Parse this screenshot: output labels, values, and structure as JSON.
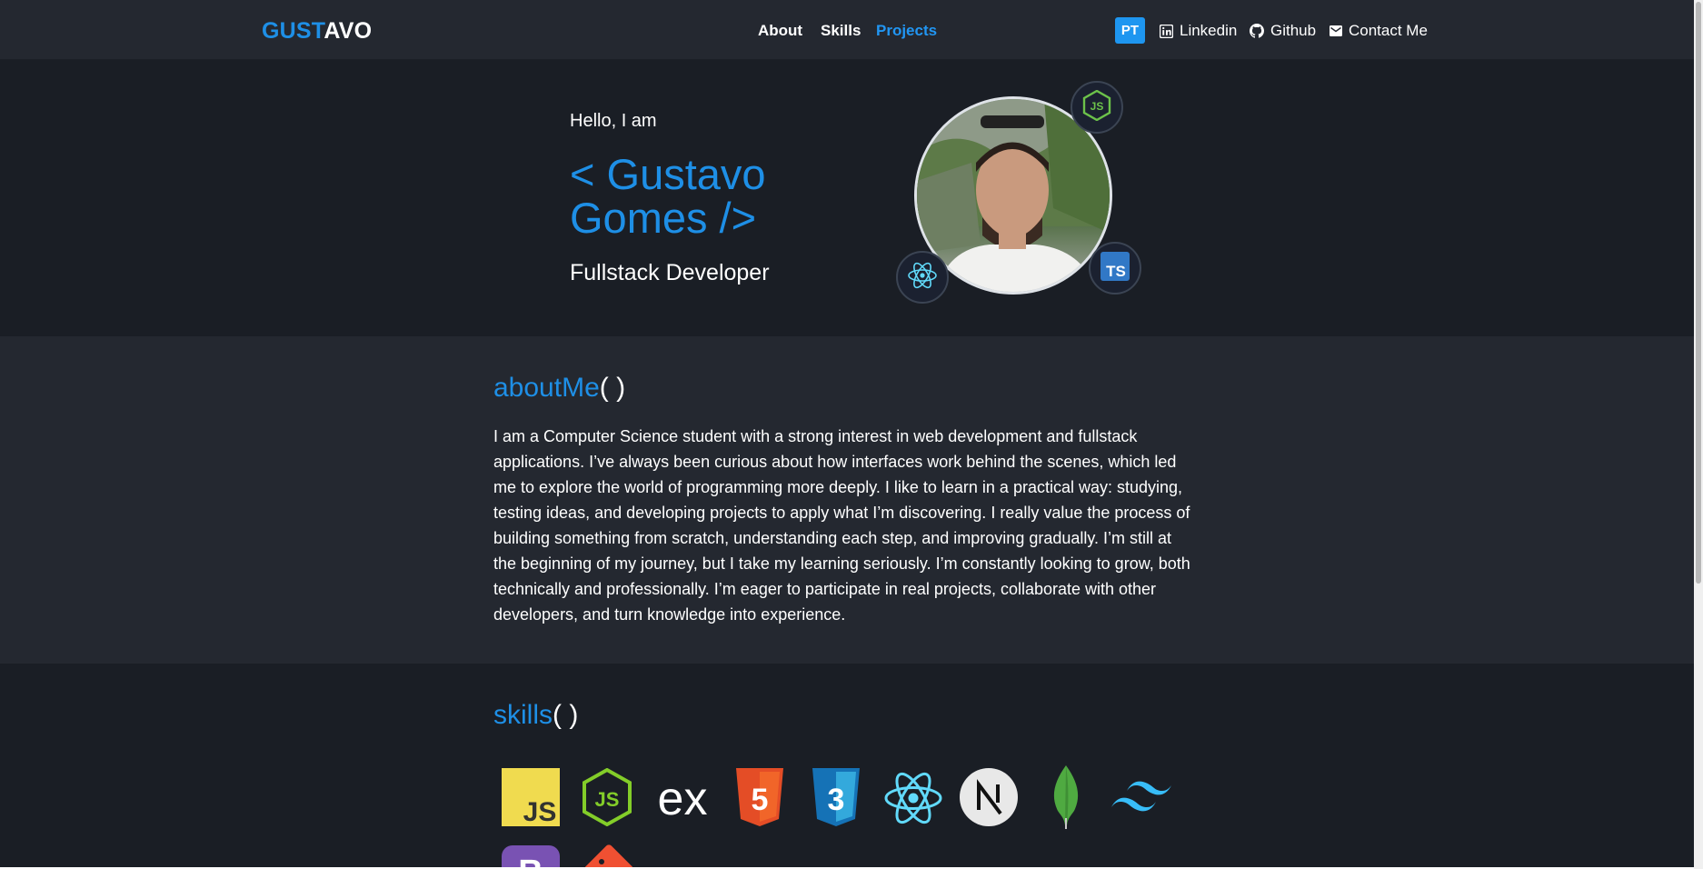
{
  "header": {
    "logo_part1": "GUST",
    "logo_part2": "AVO",
    "nav": [
      {
        "label": "About"
      },
      {
        "label": "Skills"
      },
      {
        "label": "Projects"
      }
    ],
    "lang_button": "PT",
    "links": [
      {
        "label": "Linkedin",
        "icon": "linkedin-icon"
      },
      {
        "label": "Github",
        "icon": "github-icon"
      },
      {
        "label": "Contact Me",
        "icon": "mail-icon"
      }
    ]
  },
  "hero": {
    "greeting": "Hello, I am",
    "name": "< Gustavo Gomes />",
    "role": "Fullstack Developer",
    "photo": "profile-photo",
    "badges": [
      "nodejs-icon",
      "react-icon",
      "typescript-icon"
    ]
  },
  "about": {
    "title": "aboutMe",
    "parens": "( )",
    "text": "I am a Computer Science student with a strong interest in web development and fullstack applications. I’ve always been curious about how interfaces work behind the scenes, which led me to explore the world of programming more deeply. I like to learn in a practical way: studying, testing ideas, and developing projects to apply what I’m discovering. I really value the process of building something from scratch, understanding each step, and improving gradually. I’m still at the beginning of my journey, but I take my learning seriously. I’m constantly looking to grow, both technically and professionally. I’m eager to participate in real projects, collaborate with other developers, and turn knowledge into experience."
  },
  "skills": {
    "title": "skills",
    "parens": "( )",
    "icons": [
      "javascript-icon",
      "nodejs-icon",
      "express-icon",
      "html5-icon",
      "css3-icon",
      "react-icon",
      "nextjs-icon",
      "mongodb-icon",
      "tailwind-icon",
      "bootstrap-icon",
      "git-icon"
    ]
  },
  "colors": {
    "accent": "#1e8fe6",
    "background": "#1a1e25",
    "section_alt": "#242830"
  }
}
